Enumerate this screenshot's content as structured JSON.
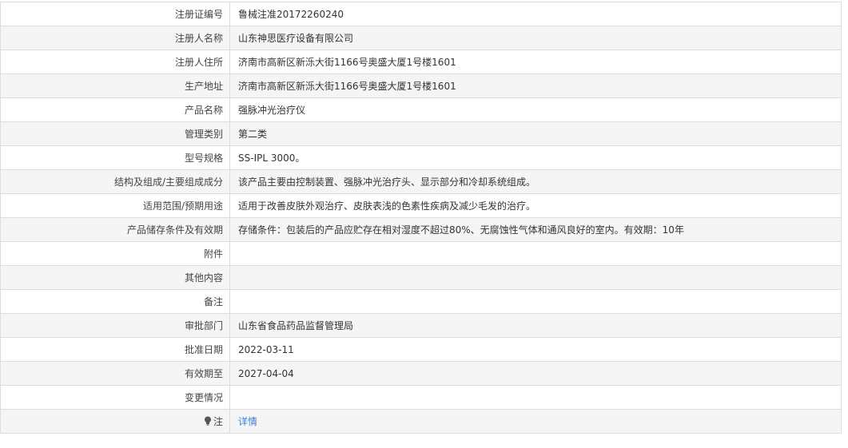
{
  "rows": [
    {
      "label": "注册证编号",
      "value": "鲁械注准20172260240"
    },
    {
      "label": "注册人名称",
      "value": "山东神思医疗设备有限公司"
    },
    {
      "label": "注册人住所",
      "value": "济南市高新区新泺大街1166号奥盛大厦1号楼1601"
    },
    {
      "label": "生产地址",
      "value": "济南市高新区新泺大街1166号奥盛大厦1号楼1601"
    },
    {
      "label": "产品名称",
      "value": "强脉冲光治疗仪"
    },
    {
      "label": "管理类别",
      "value": "第二类"
    },
    {
      "label": "型号规格",
      "value": "SS-IPL 3000。"
    },
    {
      "label": "结构及组成/主要组成成分",
      "value": "该产品主要由控制装置、强脉冲光治疗头、显示部分和冷却系统组成。"
    },
    {
      "label": "适用范围/预期用途",
      "value": "适用于改善皮肤外观治疗、皮肤表浅的色素性疾病及减少毛发的治疗。"
    },
    {
      "label": "产品储存条件及有效期",
      "value": "存储条件：包装后的产品应贮存在相对湿度不超过80%、无腐蚀性气体和通风良好的室内。有效期：10年"
    },
    {
      "label": "附件",
      "value": ""
    },
    {
      "label": "其他内容",
      "value": ""
    },
    {
      "label": "备注",
      "value": ""
    },
    {
      "label": "审批部门",
      "value": "山东省食品药品监督管理局"
    },
    {
      "label": "批准日期",
      "value": "2022-03-11"
    },
    {
      "label": "有效期至",
      "value": "2027-04-04"
    },
    {
      "label": "变更情况",
      "value": ""
    }
  ],
  "note_row": {
    "icon": "lightbulb-icon",
    "label": "注",
    "link_text": "详情"
  },
  "colors": {
    "border": "#dddddd",
    "stripe": "#f5f5f5",
    "link": "#3b7fd4"
  }
}
